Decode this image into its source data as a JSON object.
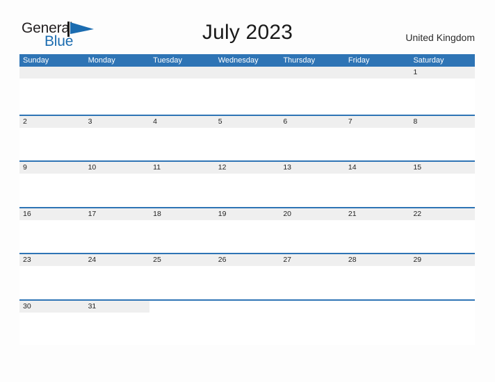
{
  "brand": {
    "name_part1": "General",
    "name_part2": "Blue",
    "flag_icon": "blue-triangle-flag",
    "accent_color": "#1b6cb0"
  },
  "header": {
    "title": "July 2023",
    "country": "United Kingdom"
  },
  "colors": {
    "header_blue": "#2e74b5",
    "row_band_gray": "#efefef",
    "page_background": "#fdfdfd",
    "text_dark": "#232323"
  },
  "calendar": {
    "month": "July",
    "year": "2023",
    "weekday_headers": [
      "Sunday",
      "Monday",
      "Tuesday",
      "Wednesday",
      "Thursday",
      "Friday",
      "Saturday"
    ],
    "weeks": [
      [
        "",
        "",
        "",
        "",
        "",
        "",
        "1"
      ],
      [
        "2",
        "3",
        "4",
        "5",
        "6",
        "7",
        "8"
      ],
      [
        "9",
        "10",
        "11",
        "12",
        "13",
        "14",
        "15"
      ],
      [
        "16",
        "17",
        "18",
        "19",
        "20",
        "21",
        "22"
      ],
      [
        "23",
        "24",
        "25",
        "26",
        "27",
        "28",
        "29"
      ],
      [
        "30",
        "31",
        "",
        "",
        "",
        "",
        ""
      ]
    ]
  }
}
